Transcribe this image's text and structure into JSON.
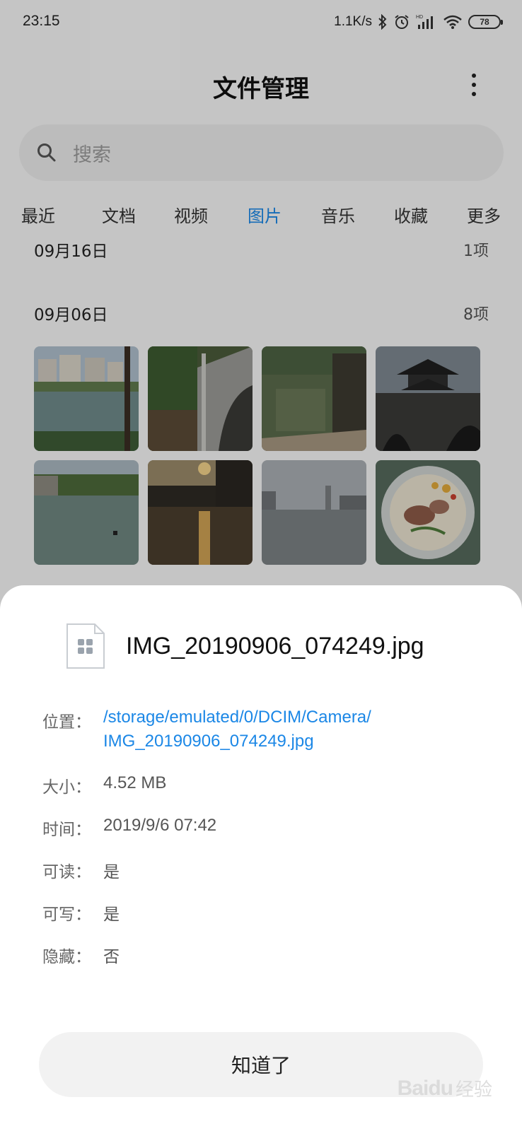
{
  "status_bar": {
    "time": "23:15",
    "network_speed": "1.1K/s",
    "battery": "78"
  },
  "header": {
    "title": "文件管理"
  },
  "search": {
    "placeholder": "搜索"
  },
  "tabs": [
    {
      "label": "最近"
    },
    {
      "label": "文档"
    },
    {
      "label": "视频"
    },
    {
      "label": "图片",
      "active": true
    },
    {
      "label": "音乐"
    },
    {
      "label": "收藏"
    },
    {
      "label": "更多"
    }
  ],
  "sections": [
    {
      "date": "09月16日",
      "count": "1项"
    },
    {
      "date": "09月06日",
      "count": "8项"
    }
  ],
  "thumbnails": [
    {
      "name": "riverside-buildings"
    },
    {
      "name": "stone-bridge-arch"
    },
    {
      "name": "blurred-bridge"
    },
    {
      "name": "pavilion-bridge"
    },
    {
      "name": "river-boat"
    },
    {
      "name": "sunset-river"
    },
    {
      "name": "city-river"
    },
    {
      "name": "noodle-bowl"
    }
  ],
  "dialog": {
    "file_name": "IMG_20190906_074249.jpg",
    "location_label": "位置：",
    "location_line1": "/storage/emulated/0/DCIM/Camera/",
    "location_line2": "IMG_20190906_074249.jpg",
    "size_label": "大小：",
    "size_value": "4.52 MB",
    "time_label": "时间：",
    "time_value": "2019/9/6 07:42",
    "readable_label": "可读：",
    "readable_value": "是",
    "writable_label": "可写：",
    "writable_value": "是",
    "hidden_label": "隐藏：",
    "hidden_value": "否",
    "ok_button": "知道了"
  },
  "watermark": {
    "text": "Baidu",
    "suffix": "经验"
  },
  "colors": {
    "accent": "#1b87e6",
    "sheet_bg": "#ffffff",
    "page_bg": "#f7f7f7"
  }
}
